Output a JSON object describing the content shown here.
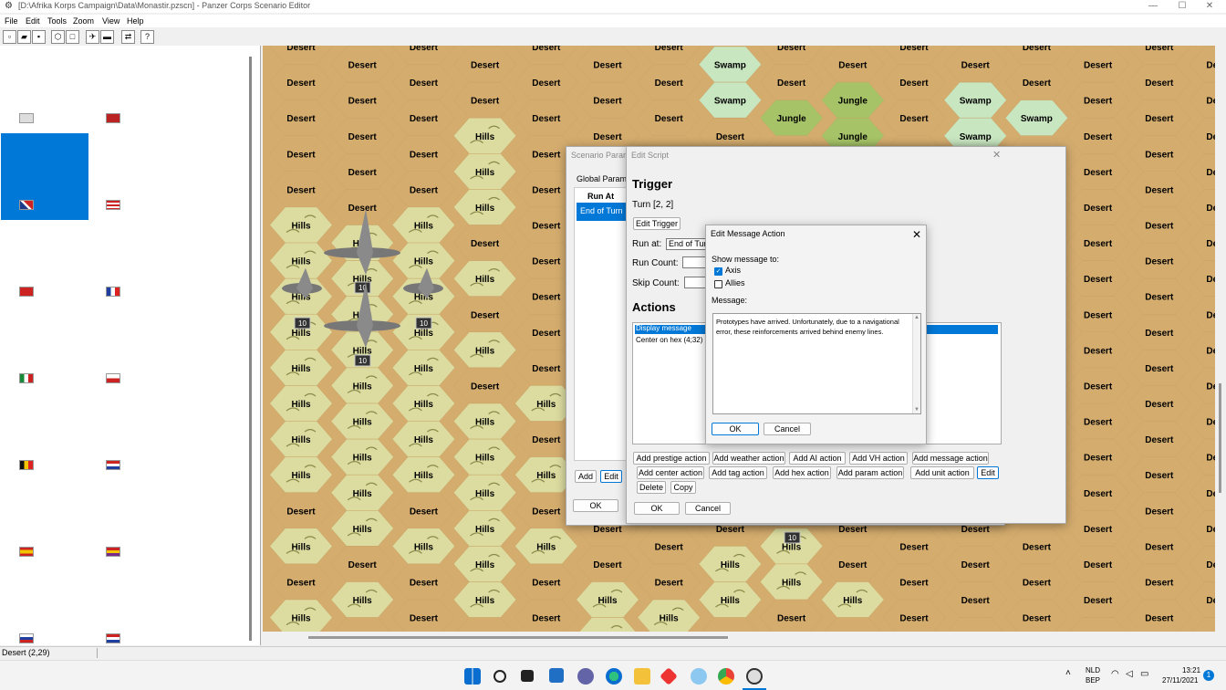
{
  "window": {
    "title": "[D:\\Afrika Korps Campaign\\Data\\Monastir.pzscn] - Panzer Corps Scenario Editor"
  },
  "menu": [
    "File",
    "Edit",
    "Tools",
    "Zoom",
    "View",
    "Help"
  ],
  "status": {
    "text": "Desert (2,29)"
  },
  "map": {
    "units": [
      {
        "strength": "10"
      },
      {
        "strength": "10"
      },
      {
        "strength": "10"
      },
      {
        "strength": "10"
      },
      {
        "strength": "10"
      }
    ]
  },
  "scenario_dialog": {
    "title": "Scenario Parameters",
    "tab": "Global Parame",
    "column_header": "Run At",
    "selected_row": "End of Turn",
    "add_label": "Add",
    "edit_label": "Edit",
    "ok_label": "OK"
  },
  "script_dialog": {
    "title": "Edit Script",
    "trigger_heading": "Trigger",
    "trigger_value": "Turn [2, 2]",
    "edit_trigger": "Edit Trigger",
    "run_at_label": "Run at:",
    "run_at_value": "End of Turn",
    "run_count_label": "Run Count:",
    "skip_count_label": "Skip Count:",
    "actions_heading": "Actions",
    "actions": [
      "Display message",
      "Center on hex (4;32)"
    ],
    "buttons_row1": [
      "Add prestige action",
      "Add weather action",
      "Add AI action",
      "Add VH action",
      "Add message action"
    ],
    "buttons_row2": [
      "Add center action",
      "Add tag action",
      "Add hex action",
      "Add param action",
      "Add unit action",
      "Edit"
    ],
    "buttons_row3": [
      "Delete",
      "Copy"
    ],
    "ok_label": "OK",
    "cancel_label": "Cancel"
  },
  "message_dialog": {
    "title": "Edit Message Action",
    "show_to_label": "Show message to:",
    "axis_label": "Axis",
    "axis_checked": true,
    "allies_label": "Allies",
    "allies_checked": false,
    "message_label": "Message:",
    "message_text": "Prototypes have arrived. Unfortunately, due to a navigational error, these reinforcements arrived behind enemy lines.",
    "ok_label": "OK",
    "cancel_label": "Cancel"
  },
  "tray": {
    "lang1": "NLD",
    "lang2": "BEP",
    "time": "13:21",
    "date": "27/11/2021",
    "badge": "1"
  },
  "colors": {
    "desert": "#d4ac6e",
    "hills": "#dcdca0",
    "jungle": "#a6c467",
    "swamp": "#c8e6c0",
    "accent": "#0078d7"
  }
}
